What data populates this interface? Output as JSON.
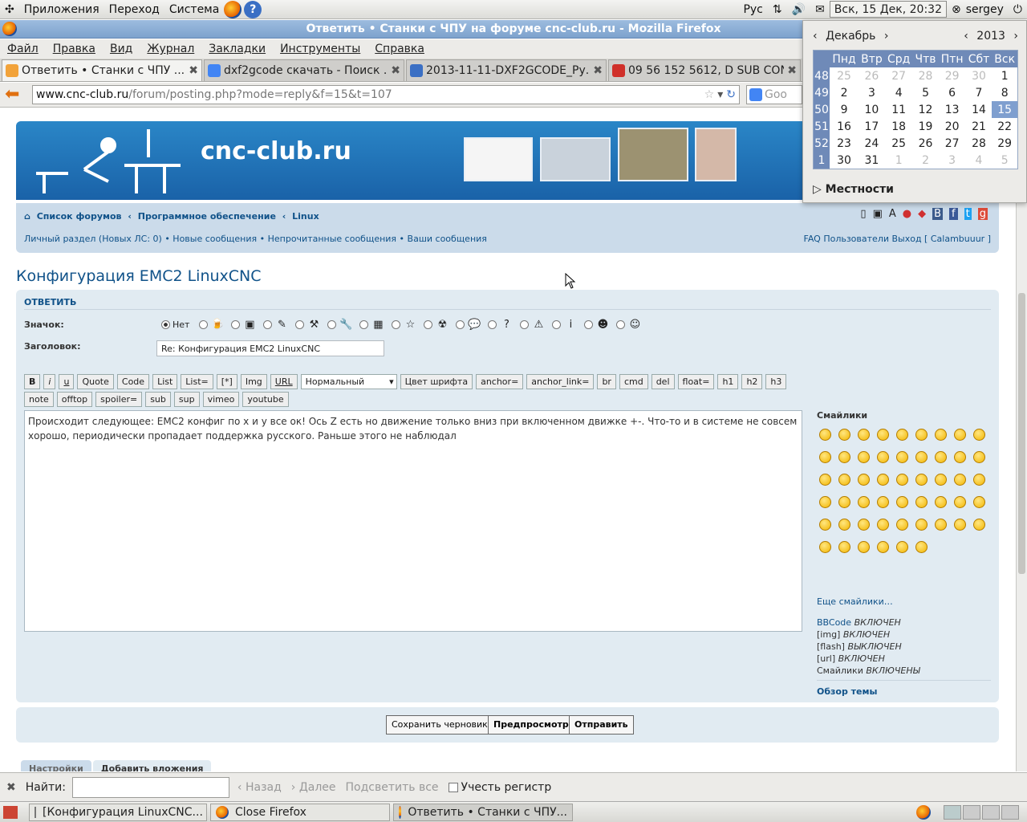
{
  "panel": {
    "apps": "Приложения",
    "places": "Переход",
    "system": "Система",
    "help_glyph": "?",
    "layout": "Рус",
    "clock": "Вск, 15 Дек, 20:32",
    "user": "sergey"
  },
  "window": {
    "title": "Ответить • Станки с ЧПУ на форуме cnc-club.ru - Mozilla Firefox"
  },
  "menu": [
    "Файл",
    "Правка",
    "Вид",
    "Журнал",
    "Закладки",
    "Инструменты",
    "Справка"
  ],
  "tabs": [
    {
      "label": "Ответить • Станки с ЧПУ ...",
      "color": "#f2a33a"
    },
    {
      "label": "dxf2gcode скачать - Поиск ...",
      "color": "#4285f4"
    },
    {
      "label": "2013-11-11-DXF2GCODE_Ру...",
      "color": "#3a6fc4"
    },
    {
      "label": "09 56 152 5612, D SUB CON...",
      "color": "#d0302a"
    }
  ],
  "nav": {
    "url_host": "www.cnc-club.ru",
    "url_path": "/forum/posting.php?mode=reply&f=15&t=107",
    "search_placeholder": "Goo"
  },
  "site": {
    "logo": "cnc-club.ru",
    "crumbs": [
      "Список форумов",
      "Программное обеспечение",
      "Linux"
    ],
    "crumb_sep": "‹",
    "user_links": "Личный раздел (Новых ЛС: 0) • Новые сообщения • Непрочитанные сообщения • Ваши сообщения",
    "right_links": "FAQ   Пользователи   Выход [ Calambuuur ]",
    "page_title": "Конфигурация EMC2 LinuxCNC"
  },
  "form": {
    "header": "ОТВЕТИТЬ",
    "icon_label": "Значок:",
    "icon_none": "Нет",
    "icon_glyphs": [
      "🍺",
      "▣",
      "✎",
      "⚒",
      "🔧",
      "▦",
      "☆",
      "☢",
      "💬",
      "?",
      "⚠",
      "i",
      "☻",
      "☺"
    ],
    "subject_label": "Заголовок:",
    "subject_value": "Re: Конфигурация EMC2 LinuxCNC",
    "bbcode_buttons": [
      "B",
      "i",
      "u",
      "Quote",
      "Code",
      "List",
      "List=",
      "[*]",
      "Img",
      "URL"
    ],
    "font_size": "Нормальный",
    "bbcode_buttons2": [
      "Цвет шрифта",
      "anchor=",
      "anchor_link=",
      "br",
      "cmd",
      "del",
      "float=",
      "h1",
      "h2",
      "h3",
      "note",
      "offtop",
      "spoiler=",
      "sub",
      "sup",
      "vimeo",
      "youtube"
    ],
    "message": "Происходит следующее: EMC2 конфиг по х и у все ок! Ось Z есть но движение только вниз при включенном движке +-. Что-то и в системе не совсем хорошо, периодически пропадает поддержка русского. Раньше этого не наблюдал",
    "smilies_title": "Смайлики",
    "smilies_more": "Еще смайлики…",
    "bbinfo": [
      {
        "k": "BBCode",
        "v": "ВКЛЮЧЕН"
      },
      {
        "k": "[img]",
        "v": "ВКЛЮЧЕН"
      },
      {
        "k": "[flash]",
        "v": "ВЫКЛЮЧЕН"
      },
      {
        "k": "[url]",
        "v": "ВКЛЮЧЕН"
      },
      {
        "k": "Смайлики",
        "v": "ВКЛЮЧЕНЫ"
      }
    ],
    "overview": "Обзор темы",
    "btn_draft": "Сохранить черновик",
    "btn_preview": "Предпросмотр",
    "btn_submit": "Отправить",
    "opt_tabs": [
      "Настройки",
      "Добавить вложения"
    ]
  },
  "find": {
    "close_glyph": "✖",
    "label": "Найти:",
    "prev": "‹ Назад",
    "next": "› Далее",
    "highlight": "Подсветить все",
    "case": "Учесть регистр"
  },
  "taskbar": [
    "[Конфигурация LinuxCNC...",
    "Close Firefox",
    "Ответить • Станки с ЧПУ..."
  ],
  "calendar": {
    "month": "Декабрь",
    "year": "2013",
    "days": [
      "Пнд",
      "Втр",
      "Срд",
      "Чтв",
      "Птн",
      "Сбт",
      "Вск"
    ],
    "weeks": [
      {
        "n": "48",
        "d": [
          "25",
          "26",
          "27",
          "28",
          "29",
          "30",
          "1"
        ]
      },
      {
        "n": "49",
        "d": [
          "2",
          "3",
          "4",
          "5",
          "6",
          "7",
          "8"
        ]
      },
      {
        "n": "50",
        "d": [
          "9",
          "10",
          "11",
          "12",
          "13",
          "14",
          "15"
        ]
      },
      {
        "n": "51",
        "d": [
          "16",
          "17",
          "18",
          "19",
          "20",
          "21",
          "22"
        ]
      },
      {
        "n": "52",
        "d": [
          "23",
          "24",
          "25",
          "26",
          "27",
          "28",
          "29"
        ]
      },
      {
        "n": "1",
        "d": [
          "30",
          "31",
          "1",
          "2",
          "3",
          "4",
          "5"
        ]
      }
    ],
    "locations": "Местности"
  }
}
